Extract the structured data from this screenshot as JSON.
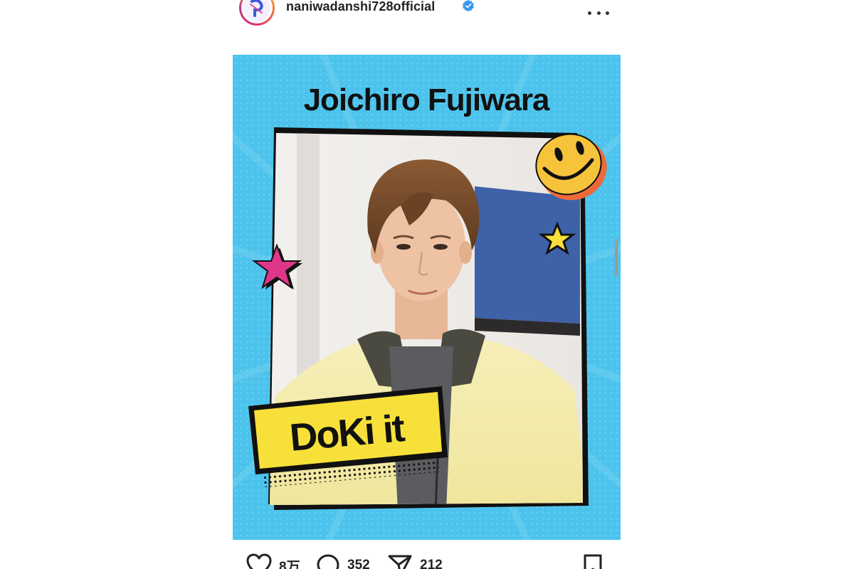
{
  "post": {
    "username": "naniwadanshi728official",
    "verified": true,
    "avatar_logo": "naniwa-danshi-logo",
    "more_icon": "more-options-icon"
  },
  "image": {
    "title": "Joichiro Fujiwara",
    "sticker_text": "DoKi it",
    "background_color": "#4cc3ec",
    "sticker_color": "#f7e03a",
    "smiley_color": "#f6c33b",
    "star_colors": [
      "#e0368a",
      "#f7e03a"
    ]
  },
  "actions": {
    "likes": "8万",
    "comments": "352",
    "shares": "212",
    "like_icon": "heart-icon",
    "comment_icon": "comment-icon",
    "share_icon": "send-icon",
    "save_icon": "bookmark-icon"
  }
}
